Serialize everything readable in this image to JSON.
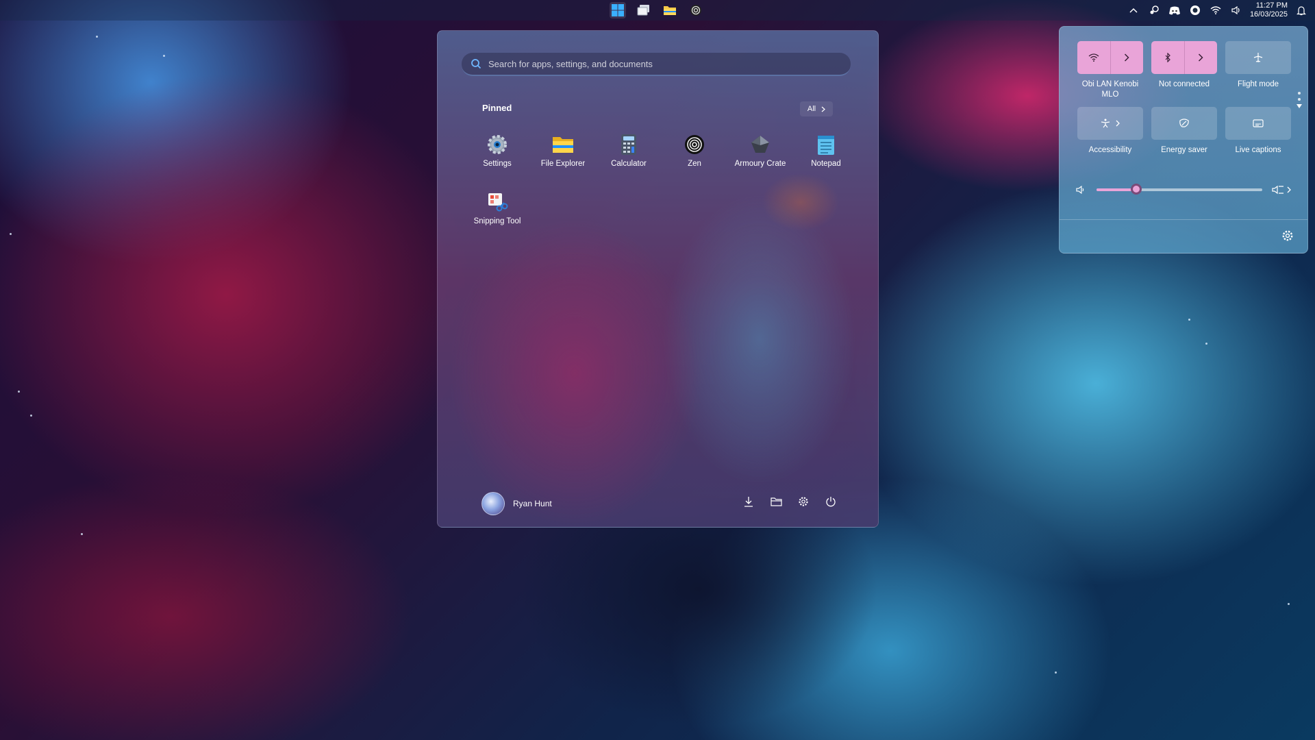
{
  "taskbar": {
    "apps": [
      {
        "name": "start-button",
        "icon": "windows-logo-icon"
      },
      {
        "name": "task-view-button",
        "icon": "task-view-icon"
      },
      {
        "name": "file-explorer-button",
        "icon": "folder-icon"
      },
      {
        "name": "zen-button",
        "icon": "zen-icon"
      }
    ],
    "tray": [
      "chevron-up-icon",
      "steam-icon",
      "discord-icon",
      "app-icon",
      "wifi-icon",
      "volume-icon"
    ],
    "clock": {
      "time": "11:27 PM",
      "date": "16/03/2025"
    }
  },
  "start_menu": {
    "search_placeholder": "Search for apps, settings, and documents",
    "pinned_label": "Pinned",
    "all_label": "All",
    "apps": [
      {
        "label": "Settings",
        "icon": "settings-gear-icon"
      },
      {
        "label": "File Explorer",
        "icon": "folder-icon"
      },
      {
        "label": "Calculator",
        "icon": "calculator-icon"
      },
      {
        "label": "Zen",
        "icon": "zen-icon"
      },
      {
        "label": "Armoury Crate",
        "icon": "armoury-crate-icon"
      },
      {
        "label": "Notepad",
        "icon": "notepad-icon"
      },
      {
        "label": "Snipping Tool",
        "icon": "snipping-tool-icon"
      }
    ],
    "user_name": "Ryan Hunt",
    "footer_icons": [
      "download-icon",
      "folder-open-icon",
      "settings-icon",
      "power-icon"
    ]
  },
  "quick_settings": {
    "tiles": [
      {
        "label": "Obi LAN Kenobi MLO",
        "icon": "wifi-icon",
        "active": true,
        "expandable": true
      },
      {
        "label": "Not connected",
        "icon": "bluetooth-icon",
        "active": true,
        "expandable": true
      },
      {
        "label": "Flight mode",
        "icon": "airplane-icon",
        "active": false,
        "expandable": false
      },
      {
        "label": "Accessibility",
        "icon": "accessibility-icon",
        "active": false,
        "expandable": true
      },
      {
        "label": "Energy saver",
        "icon": "energy-saver-icon",
        "active": false,
        "expandable": false
      },
      {
        "label": "Live captions",
        "icon": "captions-icon",
        "active": false,
        "expandable": false
      }
    ],
    "volume_percent": 24
  },
  "colors": {
    "accent": "#e9a4d8",
    "accent_dark": "#7a4a78",
    "windows_blue": "#1e90ff"
  }
}
